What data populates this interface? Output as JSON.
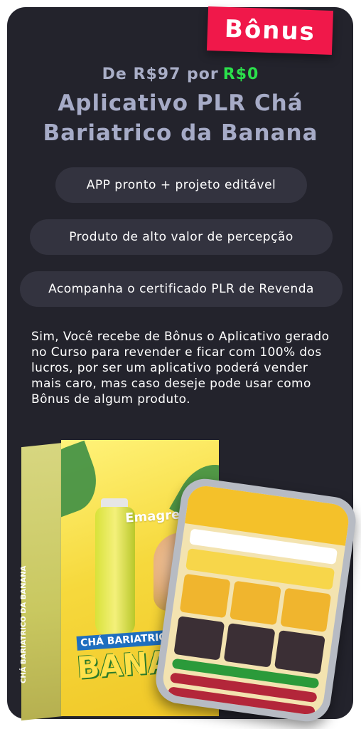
{
  "badge": {
    "label": "Bônus"
  },
  "price": {
    "prefix": "De R$97 por",
    "value": "R$0"
  },
  "title": {
    "line1": "Aplicativo PLR Chá",
    "line2": "Bariatrico da Banana"
  },
  "features": [
    "APP pronto + projeto editável",
    "Produto de alto valor de percepção",
    "Acompanha o certificado PLR de Revenda"
  ],
  "description": "Sim, Você recebe de Bônus o Aplicativo gerado no Curso para revender e ficar com 100% dos lucros, por ser um aplicativo poderá vender mais caro, mas caso deseje pode usar como Bônus de algum produto.",
  "product_box": {
    "tagline": "Emagreça com SAÚDE",
    "brand_line1": "CHÁ BARIATRICO DA",
    "brand_line2": "BANANA",
    "side_label": "CHÁ BARIATRICO DA BANANA"
  },
  "colors": {
    "card": "#23232c",
    "badge": "#f0184a",
    "price_free": "#2be04b",
    "title": "#a6abc7",
    "pill": "#33333f"
  }
}
